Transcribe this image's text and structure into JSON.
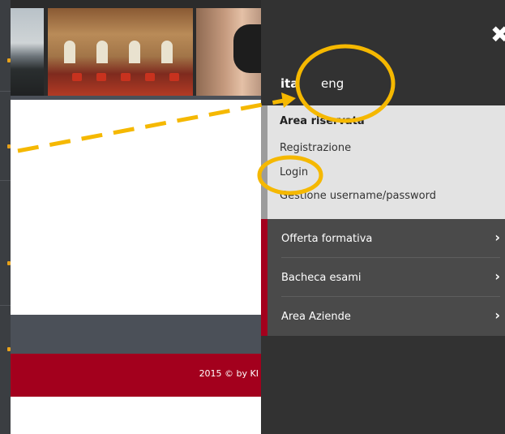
{
  "footer": {
    "copyright": "2015 © by KI"
  },
  "panel": {
    "close_icon": "close-icon",
    "languages": {
      "ita": "ita",
      "eng": "eng"
    },
    "reserved_area": {
      "title": "Area riservata",
      "links": [
        "Registrazione",
        "Login",
        "Gestione username/password"
      ]
    },
    "menu": [
      {
        "label": "Offerta formativa",
        "icon": "chevron-right-icon"
      },
      {
        "label": "Bacheca esami",
        "icon": "chevron-right-icon"
      },
      {
        "label": "Area Aziende",
        "icon": "chevron-right-icon"
      }
    ]
  },
  "annotations": {
    "color": "#f5b800"
  },
  "colors": {
    "brand_red": "#a3001d",
    "panel_bg": "#323232",
    "reserved_bg": "#e3e3e3"
  }
}
